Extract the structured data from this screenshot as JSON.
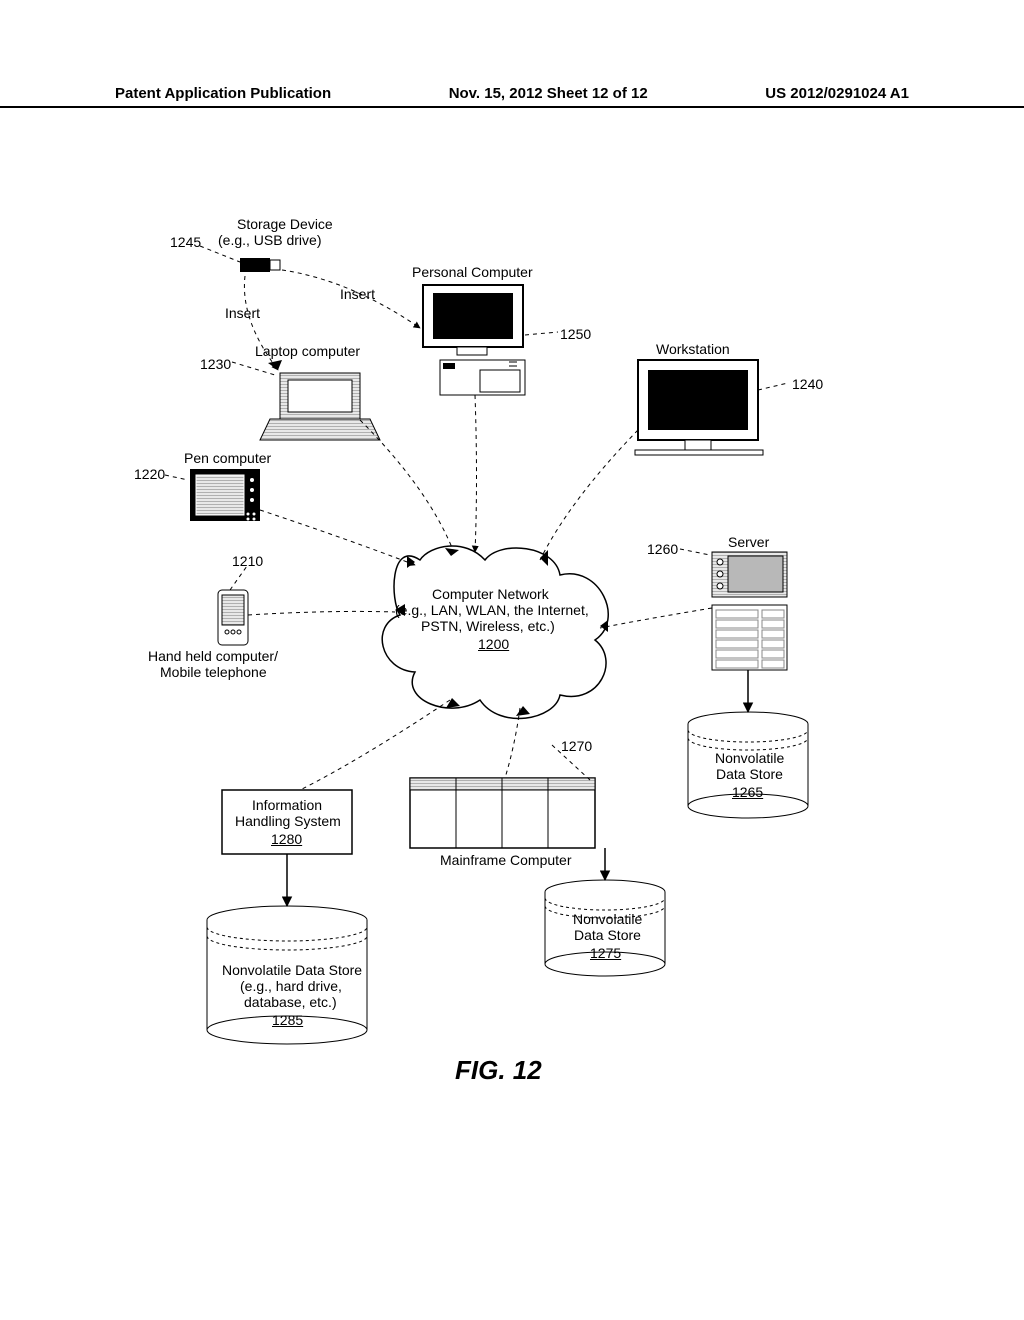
{
  "header": {
    "left": "Patent Application Publication",
    "center": "Nov. 15, 2012  Sheet 12 of 12",
    "right": "US 2012/0291024 A1"
  },
  "labels": {
    "storage_device_title": "Storage Device",
    "storage_device_sub": "(e.g., USB drive)",
    "ref_1245": "1245",
    "insert_left": "Insert",
    "insert_right": "Insert",
    "laptop": "Laptop computer",
    "ref_1230": "1230",
    "pc": "Personal Computer",
    "ref_1250": "1250",
    "workstation": "Workstation",
    "ref_1240": "1240",
    "pen": "Pen computer",
    "ref_1220": "1220",
    "handheld_1": "Hand held computer/",
    "handheld_2": "Mobile telephone",
    "ref_1210": "1210",
    "cloud_l1": "Computer Network",
    "cloud_l2": "(e.g., LAN, WLAN, the Internet,",
    "cloud_l3": "PSTN, Wireless, etc.)",
    "cloud_ref": "1200",
    "server": "Server",
    "ref_1260": "1260",
    "nv_1265_l1": "Nonvolatile",
    "nv_1265_l2": "Data Store",
    "nv_1265_ref": "1265",
    "mainframe": "Mainframe Computer",
    "ref_1270": "1270",
    "nv_1275_l1": "Nonvolatile",
    "nv_1275_l2": "Data Store",
    "nv_1275_ref": "1275",
    "ihs_l1": "Information",
    "ihs_l2": "Handling System",
    "ihs_ref": "1280",
    "nv_1285_l1": "Nonvolatile Data Store",
    "nv_1285_l2": "(e.g., hard drive,",
    "nv_1285_l3": "database, etc.)",
    "nv_1285_ref": "1285",
    "figure": "FIG. 12"
  }
}
